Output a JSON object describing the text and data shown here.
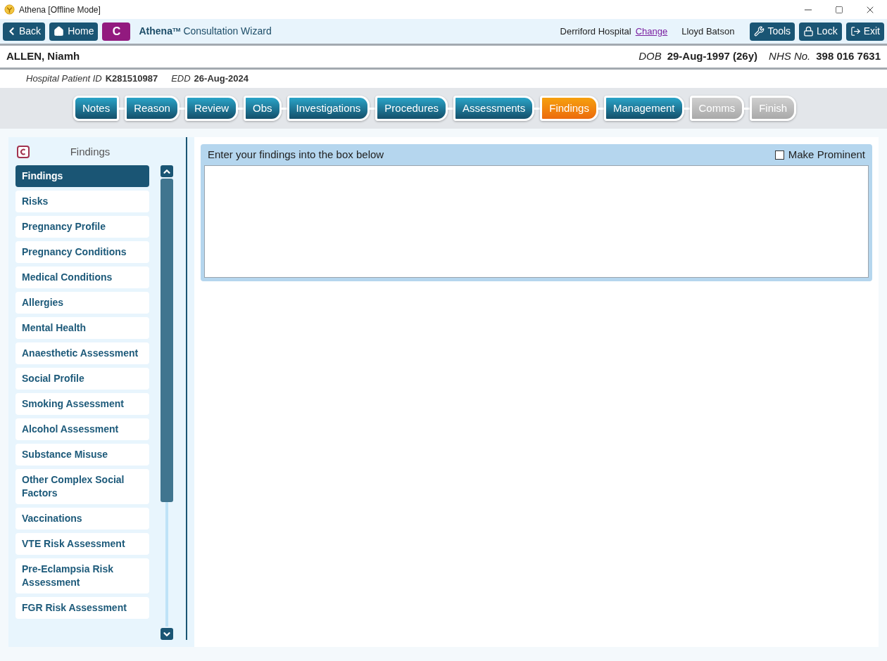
{
  "window": {
    "title": "Athena [Offline Mode]"
  },
  "toolbar": {
    "back": "Back",
    "home": "Home",
    "c_button": "C",
    "app_name": "Athena",
    "app_tm": "TM",
    "app_subtitle": "Consultation Wizard",
    "hospital": "Derriford Hospital",
    "change_link": "Change",
    "user": "Lloyd Batson",
    "tools": "Tools",
    "lock": "Lock",
    "exit": "Exit"
  },
  "patient": {
    "name": "ALLEN, Niamh",
    "dob_label": "DOB",
    "dob": "29-Aug-1997 (26y)",
    "nhs_label": "NHS No.",
    "nhs": "398 016 7631",
    "hospital_id_label": "Hospital Patient ID",
    "hospital_id": "K281510987",
    "edd_label": "EDD",
    "edd": "26-Aug-2024"
  },
  "steps": [
    {
      "label": "Notes",
      "selected": false,
      "disabled": false
    },
    {
      "label": "Reason",
      "selected": false,
      "disabled": false
    },
    {
      "label": "Review",
      "selected": false,
      "disabled": false
    },
    {
      "label": "Obs",
      "selected": false,
      "disabled": false
    },
    {
      "label": "Investigations",
      "selected": false,
      "disabled": false
    },
    {
      "label": "Procedures",
      "selected": false,
      "disabled": false
    },
    {
      "label": "Assessments",
      "selected": false,
      "disabled": false
    },
    {
      "label": "Findings",
      "selected": true,
      "disabled": false
    },
    {
      "label": "Management",
      "selected": false,
      "disabled": false
    },
    {
      "label": "Comms",
      "selected": false,
      "disabled": true
    },
    {
      "label": "Finish",
      "selected": false,
      "disabled": true
    }
  ],
  "sidebar": {
    "title": "Findings",
    "items": [
      {
        "label": "Findings",
        "selected": true
      },
      {
        "label": "Risks",
        "selected": false
      },
      {
        "label": "Pregnancy Profile",
        "selected": false
      },
      {
        "label": "Pregnancy Conditions",
        "selected": false
      },
      {
        "label": "Medical Conditions",
        "selected": false
      },
      {
        "label": "Allergies",
        "selected": false
      },
      {
        "label": "Mental Health",
        "selected": false
      },
      {
        "label": "Anaesthetic Assessment",
        "selected": false
      },
      {
        "label": "Social Profile",
        "selected": false
      },
      {
        "label": "Smoking Assessment",
        "selected": false
      },
      {
        "label": "Alcohol Assessment",
        "selected": false
      },
      {
        "label": "Substance Misuse",
        "selected": false
      },
      {
        "label": "Other Complex Social Factors",
        "selected": false
      },
      {
        "label": "Vaccinations",
        "selected": false
      },
      {
        "label": "VTE Risk Assessment",
        "selected": false
      },
      {
        "label": "Pre-Eclampsia Risk Assessment",
        "selected": false
      },
      {
        "label": "FGR Risk Assessment",
        "selected": false
      }
    ]
  },
  "findings": {
    "prompt": "Enter your findings into the box below",
    "make_prominent": {
      "label": "Make Prominent",
      "checked": false
    }
  }
}
